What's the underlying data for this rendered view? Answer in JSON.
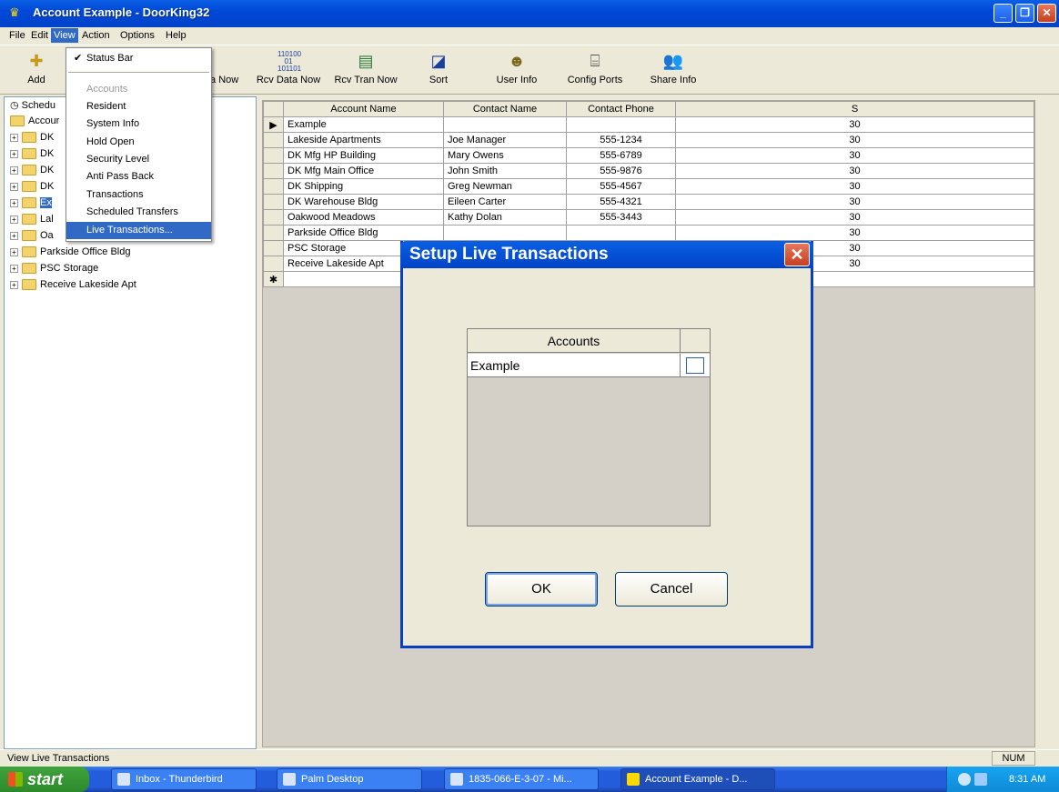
{
  "window": {
    "title": "Account Example - DoorKing32"
  },
  "menubar": [
    "File",
    "Edit",
    "View",
    "Action",
    "Options",
    "Help"
  ],
  "toolbar": {
    "add_label": "Add",
    "partial_label": "ta Now",
    "rcv_data_label": "Rcv Data Now",
    "rcv_tran_label": "Rcv Tran Now",
    "sort_label": "Sort",
    "user_info_label": "User Info",
    "config_ports_label": "Config Ports",
    "share_info_label": "Share Info"
  },
  "view_menu": {
    "status_bar": "Status Bar",
    "accounts": "Accounts",
    "resident": "Resident",
    "system_info": "System Info",
    "hold_open": "Hold Open",
    "security_level": "Security Level",
    "anti_pass_back": "Anti Pass Back",
    "transactions": "Transactions",
    "scheduled_transfers": "Scheduled Transfers",
    "live_transactions": "Live Transactions..."
  },
  "tree": {
    "items": [
      "Schedu",
      "Accour",
      "DK",
      "DK",
      "DK",
      "DK",
      "Ex",
      "Lal",
      "Oa",
      "Parkside Office Bldg",
      "PSC Storage",
      "Receive Lakeside Apt"
    ]
  },
  "grid": {
    "headers": [
      "Account Name",
      "Contact Name",
      "Contact Phone",
      "S"
    ],
    "rows": [
      [
        "Example",
        "",
        "",
        "30"
      ],
      [
        "Lakeside Apartments",
        "Joe Manager",
        "555-1234",
        "30"
      ],
      [
        "DK Mfg HP Building",
        "Mary Owens",
        "555-6789",
        "30"
      ],
      [
        "DK Mfg Main Office",
        "John Smith",
        "555-9876",
        "30"
      ],
      [
        "DK Shipping",
        "Greg Newman",
        "555-4567",
        "30"
      ],
      [
        "DK Warehouse Bldg",
        "Eileen Carter",
        "555-4321",
        "30"
      ],
      [
        "Oakwood Meadows",
        "Kathy Dolan",
        "555-3443",
        "30"
      ],
      [
        "Parkside Office Bldg",
        "",
        "",
        "30"
      ],
      [
        "PSC Storage",
        "",
        "",
        "30"
      ],
      [
        "Receive Lakeside Apt",
        "",
        "",
        "30"
      ]
    ]
  },
  "dialog": {
    "title": "Setup Live Transactions",
    "grid_header": "Accounts",
    "grid_row": "Example",
    "ok_label": "OK",
    "cancel_label": "Cancel"
  },
  "statusbar": {
    "text": "View Live Transactions",
    "num": "NUM"
  },
  "taskbar": {
    "start_label": "start",
    "tasks": [
      "Inbox - Thunderbird",
      "Palm Desktop",
      "1835-066-E-3-07 - Mi...",
      "Account Example - D..."
    ],
    "clock": "8:31 AM"
  }
}
